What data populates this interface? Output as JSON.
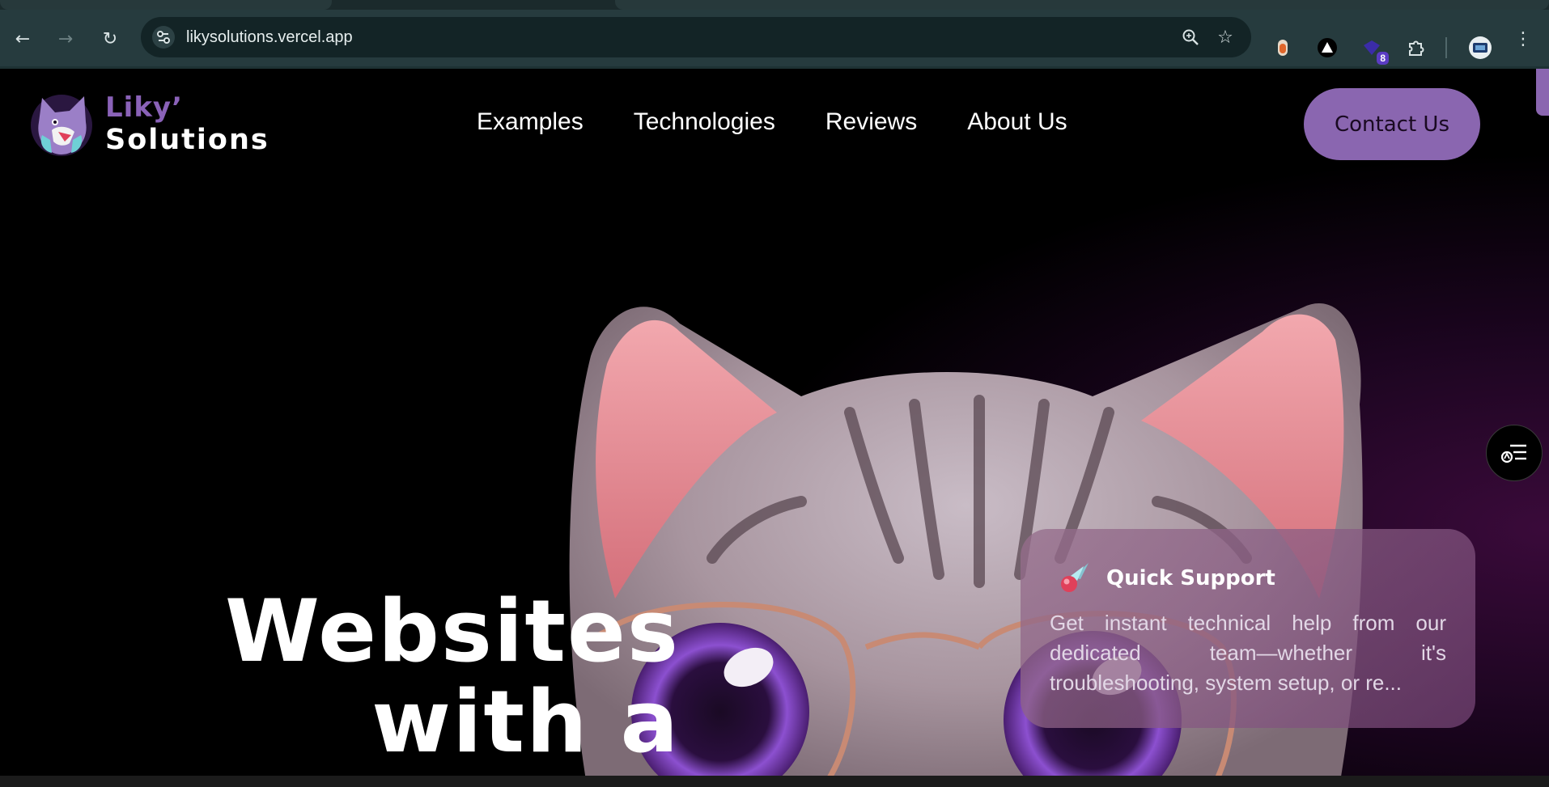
{
  "browser": {
    "url": "likysolutions.vercel.app",
    "extension_badge": "8"
  },
  "site": {
    "logo_top": "Liky’",
    "logo_bottom": "Solutions",
    "nav": [
      "Examples",
      "Technologies",
      "Reviews",
      "About Us"
    ],
    "contact_label": "Contact Us"
  },
  "hero": {
    "title_line1": "Websites",
    "title_line2": "with a"
  },
  "support_card": {
    "title": "Quick Support",
    "text": "Get instant technical help from our dedicated team—whether it's troubleshooting, system setup, or re..."
  },
  "colors": {
    "accent": "#8a66b0",
    "chrome_toolbar": "#263b3e"
  }
}
